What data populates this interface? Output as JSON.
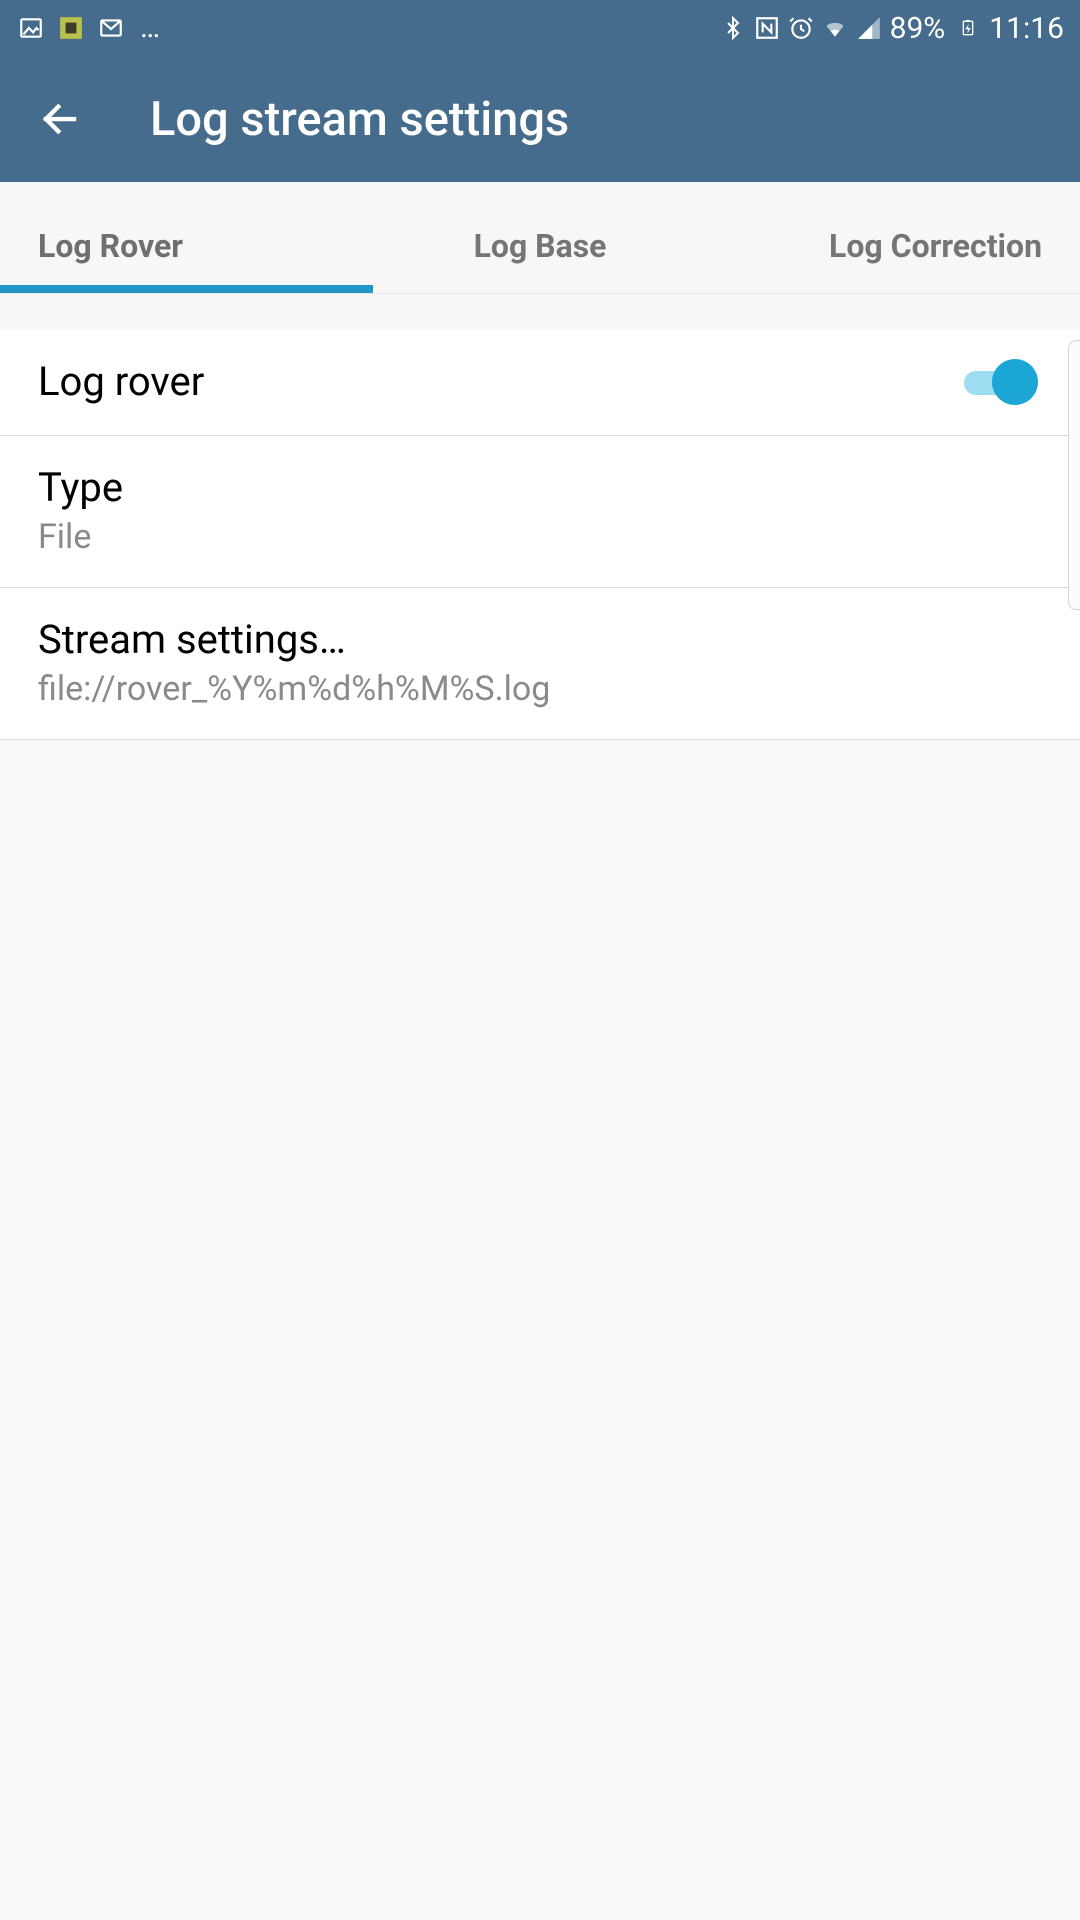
{
  "statusbar": {
    "battery_text": "89%",
    "time": "11:16"
  },
  "appbar": {
    "title": "Log stream settings"
  },
  "tabs": {
    "items": [
      {
        "label": "Log Rover",
        "active": true
      },
      {
        "label": "Log Base",
        "active": false
      },
      {
        "label": "Log Correction",
        "active": false
      }
    ]
  },
  "settings": {
    "log_rover": {
      "title": "Log rover",
      "enabled": true
    },
    "type": {
      "title": "Type",
      "value": "File"
    },
    "stream": {
      "title": "Stream settings…",
      "value": "file://rover_%Y%m%d%h%M%S.log"
    }
  }
}
